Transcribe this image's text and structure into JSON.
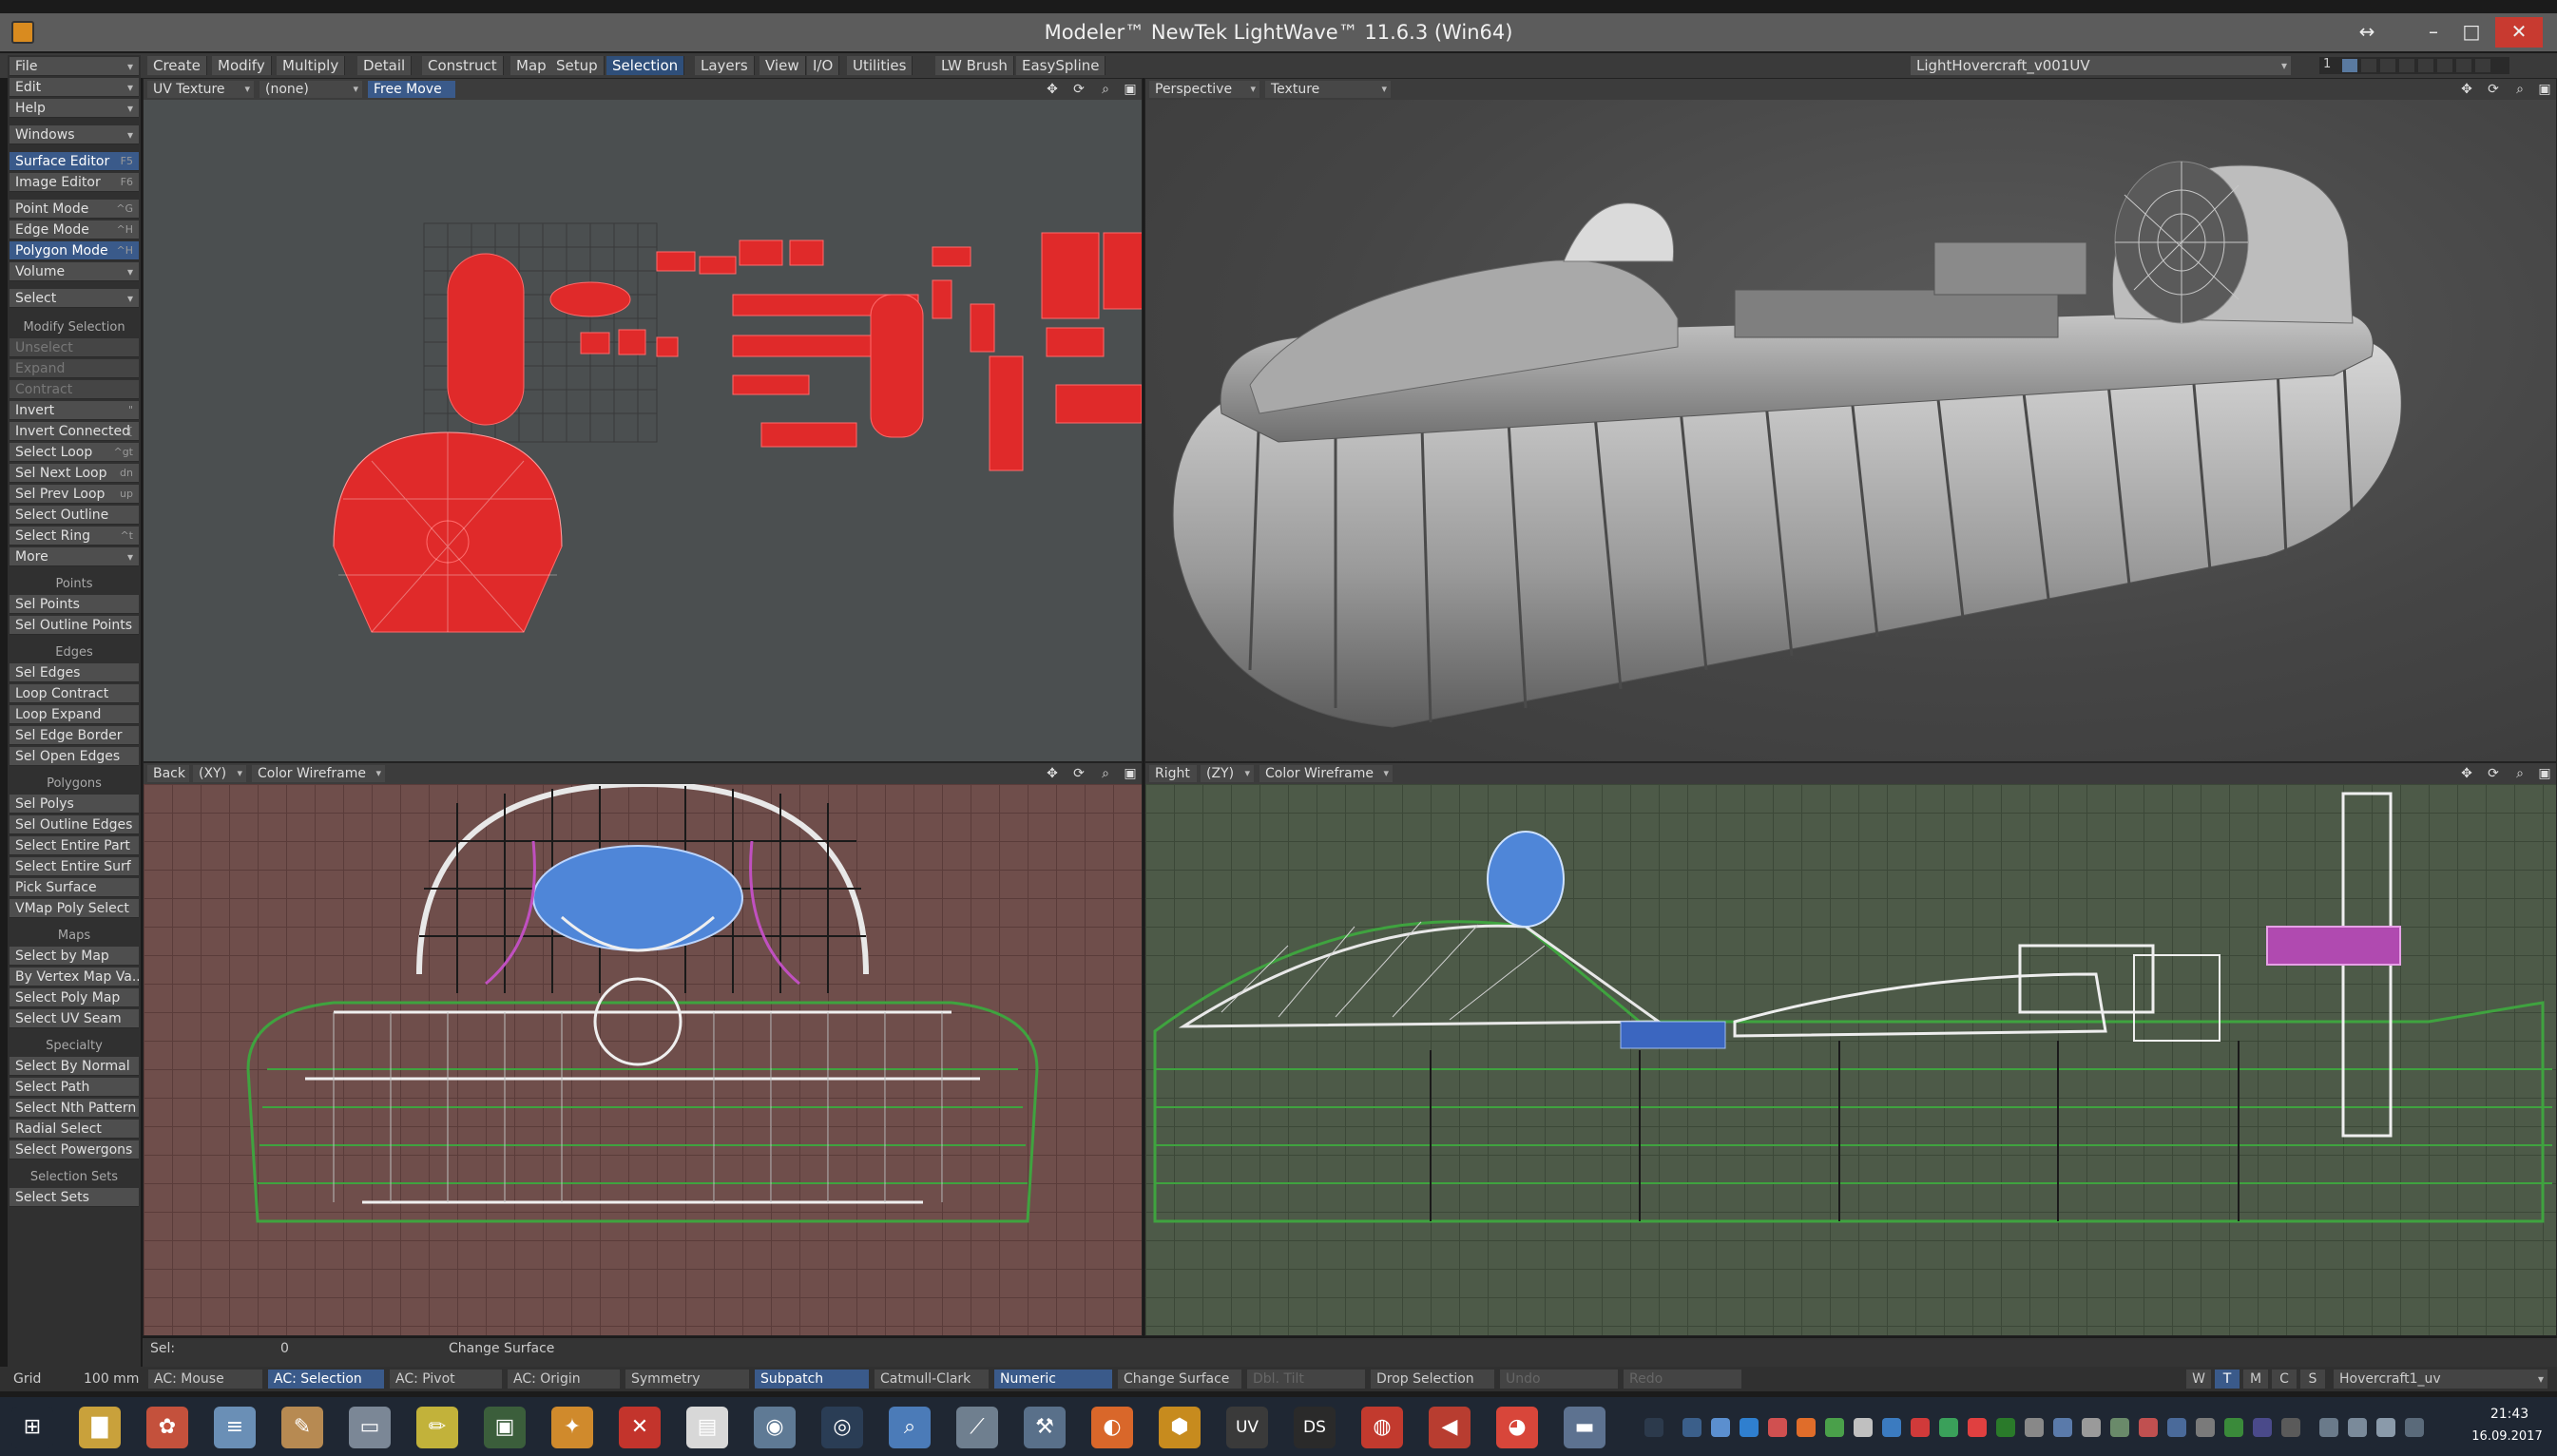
{
  "window": {
    "title": "Modeler™ NewTek LightWave™ 11.6.3 (Win64)",
    "controls": [
      "↔",
      "–",
      "□",
      "✕"
    ]
  },
  "menubar": {
    "tabs": [
      "Create",
      "Modify",
      "Multiply",
      "Detail",
      "Construct",
      "Map",
      "Setup",
      "Selection",
      "Layers",
      "View",
      "I/O",
      "Utilities",
      "LW Brush",
      "EasySpline"
    ],
    "active_tab": "Selection",
    "layer_object": "LightHovercraft_v001UV",
    "layer_number": "1"
  },
  "sidebar": {
    "top": [
      {
        "label": "File",
        "dd": true
      },
      {
        "label": "Edit",
        "dd": true
      },
      {
        "label": "Help",
        "dd": true
      },
      {
        "label": "Windows",
        "dd": true
      },
      {
        "label": "Surface Editor",
        "sc": "F5",
        "hl": true
      },
      {
        "label": "Image Editor",
        "sc": "F6"
      },
      {
        "label": "Point Mode",
        "sc": "^G"
      },
      {
        "label": "Edge Mode",
        "sc": "^H"
      },
      {
        "label": "Polygon Mode",
        "sc": "^H",
        "hl": true
      },
      {
        "label": "Volume",
        "dd": true
      },
      {
        "label": "Select",
        "dd": true
      }
    ],
    "modify_selection": {
      "heading": "Modify Selection",
      "items": [
        {
          "label": "Unselect",
          "dim": true
        },
        {
          "label": "Expand",
          "dim": true
        },
        {
          "label": "Contract",
          "dim": true
        },
        {
          "label": "Invert",
          "sc": "\""
        },
        {
          "label": "Invert Connected",
          "sc": "{"
        },
        {
          "label": "Select Loop",
          "sc": "^gt"
        },
        {
          "label": "Sel Next Loop",
          "sc": "dn"
        },
        {
          "label": "Sel Prev Loop",
          "sc": "up"
        },
        {
          "label": "Select Outline"
        },
        {
          "label": "Select Ring",
          "sc": "^t"
        },
        {
          "label": "More",
          "dd": true
        }
      ]
    },
    "points": {
      "heading": "Points",
      "items": [
        "Sel Points",
        "Sel Outline Points"
      ]
    },
    "edges": {
      "heading": "Edges",
      "items": [
        "Sel Edges",
        "Loop Contract",
        "Loop Expand",
        "Sel Edge Border",
        "Sel Open Edges"
      ]
    },
    "polygons": {
      "heading": "Polygons",
      "items": [
        "Sel Polys",
        "Sel Outline Edges",
        "Select Entire Part",
        "Select Entire Surf",
        "Pick Surface",
        "VMap Poly Select"
      ]
    },
    "maps": {
      "heading": "Maps",
      "items": [
        "Select by Map",
        "By Vertex Map Va...",
        "Select Poly Map",
        "Select UV Seam"
      ]
    },
    "specialty": {
      "heading": "Specialty",
      "items": [
        "Select By Normal",
        "Select Path",
        "Select Nth Pattern",
        "Radial Select",
        "Select Powergons"
      ]
    },
    "selection_sets": {
      "heading": "Selection Sets",
      "items": [
        "Select Sets"
      ]
    }
  },
  "viewports": {
    "uv": {
      "view": "UV Texture",
      "map": "(none)",
      "mode": "Free Move"
    },
    "persp": {
      "view": "Perspective",
      "render": "Texture"
    },
    "back": {
      "view": "Back",
      "axis": "(XY)",
      "render": "Color Wireframe"
    },
    "right": {
      "view": "Right",
      "axis": "(ZY)",
      "render": "Color Wireframe"
    }
  },
  "status": {
    "sel_label": "Sel:",
    "sel_value": "0",
    "message": "Change Surface"
  },
  "bottom_bar": {
    "grid_label": "Grid",
    "grid_value": "100 mm",
    "cells": [
      {
        "label": "AC: Mouse"
      },
      {
        "label": "AC: Selection",
        "hl": true
      },
      {
        "label": "AC: Pivot"
      },
      {
        "label": "AC: Origin"
      },
      {
        "label": "Symmetry"
      },
      {
        "label": "Subpatch",
        "hl": true
      },
      {
        "label": "Catmull-Clark"
      },
      {
        "label": "Numeric",
        "hl": true
      },
      {
        "label": "Change Surface"
      },
      {
        "label": "Dbl. Tilt",
        "dim": true
      },
      {
        "label": "Drop Selection"
      },
      {
        "label": "Undo",
        "dim": true
      },
      {
        "label": "Redo",
        "dim": true
      }
    ],
    "wtmcs": [
      "W",
      "T",
      "M",
      "C",
      "S"
    ],
    "wtmcs_on": "T",
    "uv_map": "Hovercraft1_uv"
  },
  "taskbar": {
    "apps": [
      {
        "icon": "windows-start-icon",
        "glyph": "⊞",
        "color": "#1f2733"
      },
      {
        "icon": "file-explorer-icon",
        "glyph": "▇",
        "color": "#c9a13b"
      },
      {
        "icon": "paint-icon",
        "glyph": "✿",
        "color": "#c4513c"
      },
      {
        "icon": "notepad-icon",
        "glyph": "≡",
        "color": "#6a8fb6"
      },
      {
        "icon": "paint-brush-icon",
        "glyph": "✎",
        "color": "#b78a52"
      },
      {
        "icon": "window-icon",
        "glyph": "▭",
        "color": "#7b8796"
      },
      {
        "icon": "pencil-icon",
        "glyph": "✏",
        "color": "#c2b23a"
      },
      {
        "icon": "monitor-icon",
        "glyph": "▣",
        "color": "#3b5e3b"
      },
      {
        "icon": "butterfly-icon",
        "glyph": "✦",
        "color": "#d08a2c"
      },
      {
        "icon": "cross-app-icon",
        "glyph": "✕",
        "color": "#c3342c"
      },
      {
        "icon": "document-icon",
        "glyph": "▤",
        "color": "#d8d8d8"
      },
      {
        "icon": "chrome-like-icon",
        "glyph": "◉",
        "color": "#5f7a95"
      },
      {
        "icon": "camera-icon",
        "glyph": "◎",
        "color": "#2a3d55"
      },
      {
        "icon": "magnifier-app-icon",
        "glyph": "⌕",
        "color": "#4b7bb8"
      },
      {
        "icon": "network-icon",
        "glyph": "⟋",
        "color": "#6f7f8f"
      },
      {
        "icon": "tools-icon",
        "glyph": "⚒",
        "color": "#59708a"
      },
      {
        "icon": "firefox-icon",
        "glyph": "◐",
        "color": "#d9672a"
      },
      {
        "icon": "lightwave-modeler-icon",
        "glyph": "⬢",
        "color": "#c78b1e"
      },
      {
        "icon": "uv-app-icon",
        "glyph": "UV",
        "color": "#3a3a3a"
      },
      {
        "icon": "daz-studio-icon",
        "glyph": "DS",
        "color": "#2a2a2a"
      },
      {
        "icon": "target-app-icon",
        "glyph": "◍",
        "color": "#c23a2e"
      },
      {
        "icon": "speaker-app-icon",
        "glyph": "◀",
        "color": "#b83d30"
      },
      {
        "icon": "chrome-icon",
        "glyph": "◕",
        "color": "#d8463a"
      },
      {
        "icon": "display-icon",
        "glyph": "▬",
        "color": "#5d7290"
      }
    ],
    "time": "21:43",
    "date": "16.09.2017"
  }
}
